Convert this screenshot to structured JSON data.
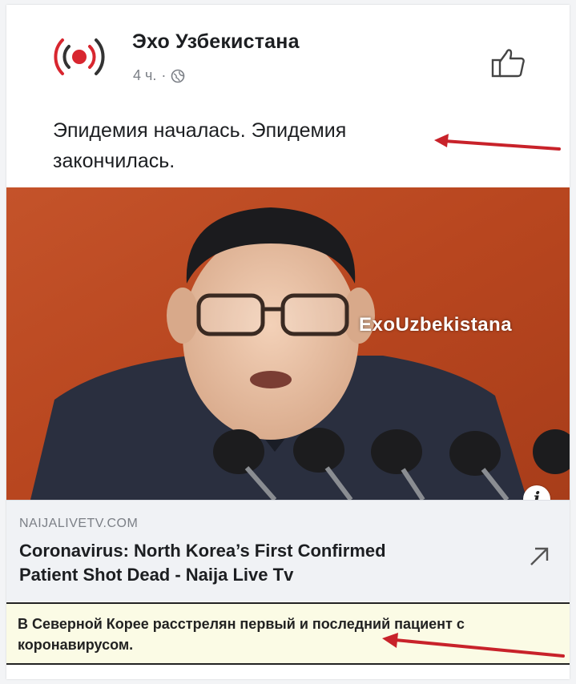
{
  "post": {
    "page_name": "Эхо Узбекистана",
    "time": "4 ч.",
    "separator": "·",
    "text_line1": "Эпидемия началась. Эпидемия",
    "text_line2": "закончилась."
  },
  "photo": {
    "watermark": "EхoUzbekistana"
  },
  "link": {
    "domain": "NAIJALIVETV.COM",
    "title_line1": "Coronavirus: North Korea’s First Confirmed",
    "title_line2": "Patient Shot Dead - Naija Live Tv"
  },
  "caption": {
    "line1": "В Северной Корее расстрелян первый и последний пациент с",
    "line2": "коронавирусом."
  },
  "colors": {
    "arrow": "#c8222a",
    "photo_background": "#b8461f",
    "link_background": "#f0f2f5"
  },
  "icons": {
    "avatar": "radio-signal-logo",
    "privacy": "globe-icon",
    "like": "thumbs-up-icon",
    "external": "external-link-arrow-icon",
    "info": "info-icon"
  }
}
